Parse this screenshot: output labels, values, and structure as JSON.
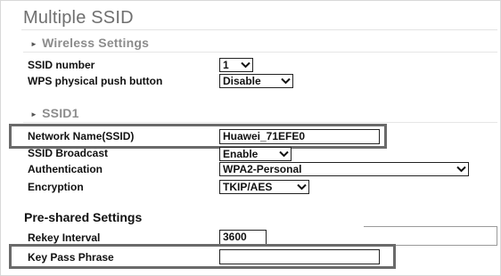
{
  "page": {
    "title": "Multiple SSID"
  },
  "wireless_settings": {
    "heading": "Wireless Settings",
    "ssid_number": {
      "label": "SSID number",
      "value": "1"
    },
    "wps_button": {
      "label": "WPS physical push button",
      "value": "Disable"
    }
  },
  "ssid1": {
    "heading": "SSID1",
    "network_name": {
      "label": "Network Name(SSID)",
      "value": "Huawei_71EFE0"
    },
    "ssid_broadcast": {
      "label": "SSID Broadcast",
      "value": "Enable"
    },
    "authentication": {
      "label": "Authentication",
      "value": "WPA2-Personal"
    },
    "encryption": {
      "label": "Encryption",
      "value": "TKIP/AES"
    }
  },
  "preshared": {
    "heading": "Pre-shared Settings",
    "rekey_interval": {
      "label": "Rekey Interval",
      "value": "3600"
    },
    "key_pass_phrase": {
      "label": "Key Pass Phrase",
      "value": ""
    }
  },
  "icons": {
    "bullet": "bullet-icon",
    "dropdown": "chevron-down-icon"
  },
  "colors": {
    "highlight_border": "#6a6a6a",
    "title_gray": "#6f6f6f",
    "section_gray": "#8c8c8c"
  }
}
